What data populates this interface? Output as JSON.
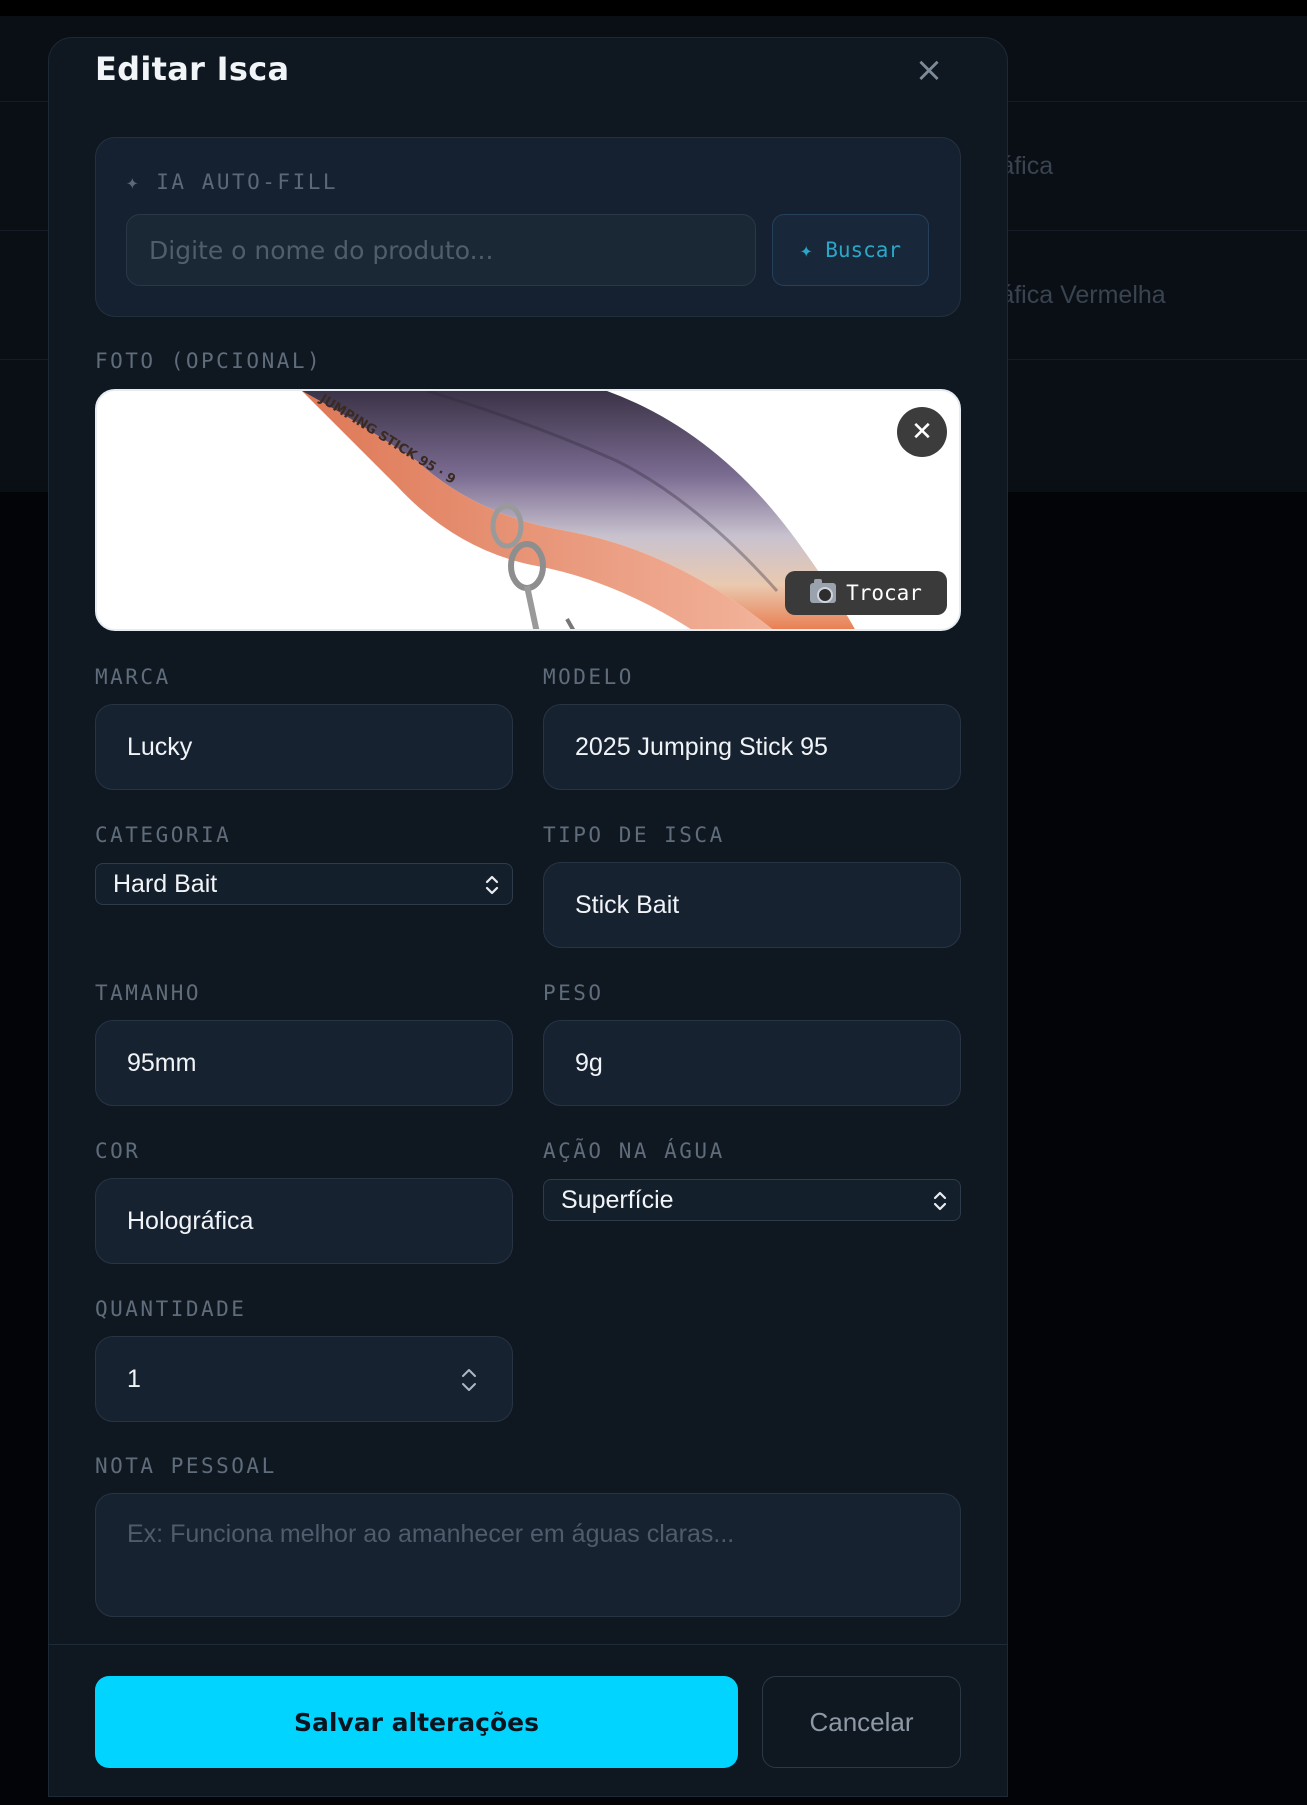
{
  "background": {
    "rows": [
      {
        "text": "ráfica"
      },
      {
        "text": "ráfica Vermelha"
      },
      {
        "text": ""
      }
    ]
  },
  "modal": {
    "title": "Editar Isca",
    "close_icon": "close-icon"
  },
  "autofill": {
    "label": "✦ IA AUTO-FILL",
    "input_placeholder": "Digite o nome do produto...",
    "input_value": "",
    "search_label": "✦ Buscar"
  },
  "photo": {
    "label": "FOTO (OPCIONAL)",
    "remove_icon": "close-icon",
    "swap_label": "Trocar",
    "swap_icon": "camera-icon"
  },
  "fields": {
    "marca": {
      "label": "MARCA",
      "value": "Lucky"
    },
    "modelo": {
      "label": "MODELO",
      "value": "2025 Jumping Stick 95"
    },
    "categoria": {
      "label": "CATEGORIA",
      "value": "Hard Bait"
    },
    "tipo": {
      "label": "TIPO DE ISCA",
      "value": "Stick Bait"
    },
    "tamanho": {
      "label": "TAMANHO",
      "value": "95mm"
    },
    "peso": {
      "label": "PESO",
      "value": "9g"
    },
    "cor": {
      "label": "COR",
      "value": "Holográfica"
    },
    "acao": {
      "label": "AÇÃO NA ÁGUA",
      "value": "Superfície"
    },
    "quantidade": {
      "label": "QUANTIDADE",
      "value": "1"
    },
    "nota": {
      "label": "NOTA PESSOAL",
      "placeholder": "Ex: Funciona melhor ao amanhecer em águas claras...",
      "value": ""
    }
  },
  "actions": {
    "save_label": "Salvar alterações",
    "cancel_label": "Cancelar"
  },
  "colors": {
    "accent": "#00d4ff",
    "modal_bg": "#0f1821",
    "field_bg": "#172231"
  }
}
